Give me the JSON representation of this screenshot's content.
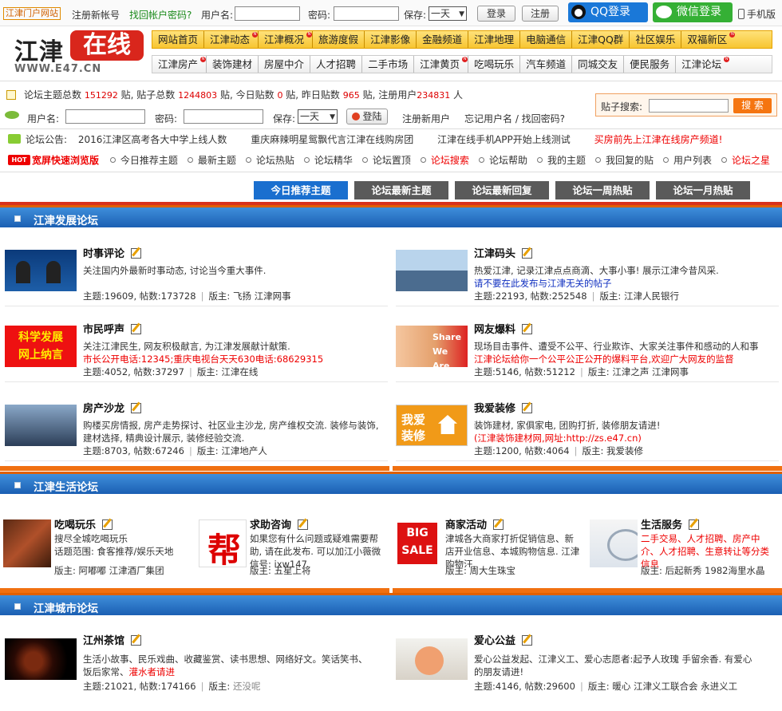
{
  "topbar": {
    "portal": "江津门户网站",
    "register": "注册新帐号",
    "recover": "找回帐户密码?",
    "username_label": "用户名:",
    "password_label": "密码:",
    "save_label": "保存:",
    "save_value": "一天",
    "login": "登录",
    "signup": "注册",
    "qq_login": "QQ登录",
    "wechat_login": "微信登录",
    "mobile": "手机版"
  },
  "logo": {
    "name1": "江津",
    "name2": "在线",
    "url": "WWW.E47.CN"
  },
  "nav": {
    "row1": [
      "网站首页",
      "江津动态",
      "江津概况",
      "旅游度假",
      "江津影像",
      "金融频道",
      "江津地理",
      "电脑通信",
      "江津QQ群",
      "社区娱乐",
      "双福新区"
    ],
    "row1_new": [
      false,
      true,
      true,
      false,
      false,
      false,
      false,
      false,
      false,
      false,
      true
    ],
    "row2": [
      "江津房产",
      "装饰建材",
      "房屋中介",
      "人才招聘",
      "二手市场",
      "江津黄页",
      "吃喝玩乐",
      "汽车频道",
      "同城交友",
      "便民服务",
      "江津论坛"
    ],
    "row2_new": [
      true,
      false,
      false,
      false,
      false,
      true,
      false,
      false,
      false,
      false,
      true
    ]
  },
  "stats": {
    "label_topics": "论坛主题总数",
    "topics": "151292",
    "label_posts": "贴, 贴子总数",
    "posts": "1244803",
    "label_today": "贴, 今日贴数",
    "today": "0",
    "label_yesterday": "贴, 昨日贴数",
    "yesterday": "965",
    "label_users": "贴, 注册用户",
    "users": "234831",
    "unit": "人"
  },
  "search": {
    "label": "贴子搜索:",
    "button": "搜 索"
  },
  "login2": {
    "username_label": "用户名:",
    "password_label": "密码:",
    "save_label": "保存:",
    "save_value": "一天",
    "login": "登陆",
    "register": "注册新用户",
    "forgot": "忘记用户名 / 找回密码?"
  },
  "notice": {
    "label": "论坛公告:",
    "items": [
      "2016江津区高考各大中学上线人数",
      "重庆麻辣明星鸳飘代言江津在线购房团",
      "江津在线手机APP开始上线测试",
      "买房前先上江津在线房产频道!"
    ]
  },
  "links": {
    "hot": "HOT",
    "wide": "宽屏快速浏览版",
    "items": [
      "今日推荐主题",
      "最新主题",
      "论坛热贴",
      "论坛精华",
      "论坛置顶",
      "论坛搜索",
      "论坛帮助",
      "我的主题",
      "我回复的贴",
      "用户列表",
      "论坛之星"
    ],
    "red": [
      false,
      false,
      false,
      false,
      false,
      true,
      false,
      false,
      false,
      false,
      true
    ]
  },
  "tabs": [
    "今日推荐主题",
    "论坛最新主题",
    "论坛最新回复",
    "论坛一周热贴",
    "论坛一月热贴"
  ],
  "sections": {
    "dev": {
      "title": "江津发展论坛",
      "forums": [
        {
          "name": "时事评论",
          "desc": "关注国内外最新时事动态, 讨论当今重大事件.",
          "desc2": "",
          "topics": "主题:19609",
          "posts": "帖数:173728",
          "mods": "版主: 飞扬 江津网事"
        },
        {
          "name": "江津码头",
          "desc": "热爱江津, 记录江津点点商滴、大事小事! 展示江津今昔风采.",
          "desc2": "请不要在此发布与江津无关的帖子",
          "topics": "主题:22193",
          "posts": "帖数:252548",
          "mods": "版主: 江津人民银行"
        },
        {
          "name": "市民呼声",
          "desc": "关注江津民生, 网友积极献言, 为江津发展献计献策.",
          "desc2": "市长公开电话:12345;重庆电视台天天630电话:68629315",
          "topics": "主题:4052",
          "posts": "帖数:37297",
          "mods": "版主: 江津在线"
        },
        {
          "name": "网友爆料",
          "desc": "现场目击事件、遭受不公平、行业欺诈、大家关注事件和感动的人和事",
          "desc2": "江津论坛给你一个公平公正公开的爆料平台,欢迎广大网友的监督",
          "topics": "主题:5146",
          "posts": "帖数:51212",
          "mods": "版主: 江津之声 江津网事"
        },
        {
          "name": "房产沙龙",
          "desc": "购楼买房情报, 房产走势探讨、社区业主沙龙, 房产维权交流. 装修与装饰, 建材选择, 精典设计展示, 装修经验交流.",
          "desc2": "",
          "topics": "主题:8703",
          "posts": "帖数:67246",
          "mods": "版主: 江津地产人"
        },
        {
          "name": "我爱装修",
          "desc": "装饰建材, 家俱家电, 团购打折, 装修朋友请进!",
          "desc2": "(江津装饰建材网,网址:http://zs.e47.cn)",
          "topics": "主题:1200",
          "posts": "帖数:4064",
          "mods": "版主: 我爱装修"
        }
      ]
    },
    "life": {
      "title": "江津生活论坛",
      "forums": [
        {
          "name": "吃喝玩乐",
          "desc": "搜尽全城吃喝玩乐",
          "desc2": "话题范围: 食客推荐/娱乐天地",
          "mods": "版主: 阿嘟嘟 江津酒厂集团"
        },
        {
          "name": "求助咨询",
          "desc": "如果您有什么问题或疑难需要帮助, 请在此发布. 可以加江小薇微信号: jxw147",
          "desc2": "",
          "mods": "版主: 五星上将"
        },
        {
          "name": "商家活动",
          "desc": "津城各大商家打折促销信息、新店开业信息、本城购物信息. 江津购物汪.",
          "desc2": "",
          "mods": "版主: 周大生珠宝"
        },
        {
          "name": "生活服务",
          "desc": "二手交易、人才招聘、房产中介、人才招聘、生意转让等分类信息",
          "desc2": "",
          "mods": "版主: 后起新秀 1982海里水晶"
        }
      ]
    },
    "city": {
      "title": "江津城市论坛",
      "forums": [
        {
          "name": "江州茶馆",
          "desc": "生活小故事、民乐戏曲、收藏鉴赏、读书思想、网络好文。笑话笑书、饭后家常、",
          "desc_red": "灌水者请进",
          "topics": "主题:21021",
          "posts": "帖数:174166",
          "mods_label": "版主:",
          "mods": "还没呢"
        },
        {
          "name": "爱心公益",
          "desc": "爱心公益发起、江津义工、爱心志愿者:起予人玫瑰 手留余香. 有爱心的朋友请进!",
          "desc_red": "",
          "topics": "主题:4146",
          "posts": "帖数:29600",
          "mods_label": "版主:",
          "mods": "暖心 江津义工联合会 永进义工"
        }
      ]
    }
  }
}
